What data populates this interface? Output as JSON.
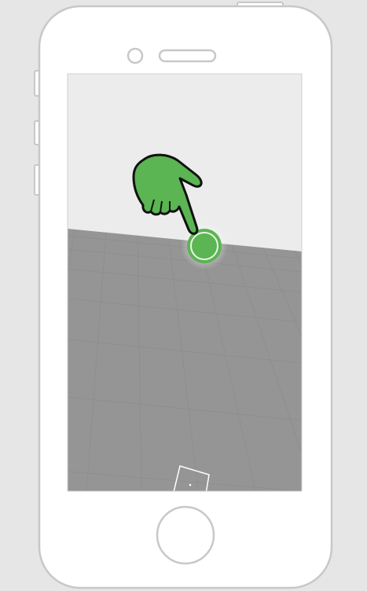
{
  "colors": {
    "page_background": "#e6e6e6",
    "phone_body": "#ffffff",
    "phone_outline": "#c8c8c8",
    "sky": "#ececec",
    "ground": "#959595",
    "grid_line": "#8a8a8a",
    "accent_green": "#5ab552",
    "hand_outline": "#111111"
  },
  "phone": {
    "speaker_icon": "speaker-grille-icon",
    "camera_icon": "front-camera-icon",
    "home_button_icon": "home-button-icon"
  },
  "screen": {
    "scene": "ar-plane-detection",
    "hint_icon": "pointing-hand-icon",
    "tap_target_icon": "tap-target-circle-icon",
    "placed_object_icon": "cube-outline-icon"
  }
}
